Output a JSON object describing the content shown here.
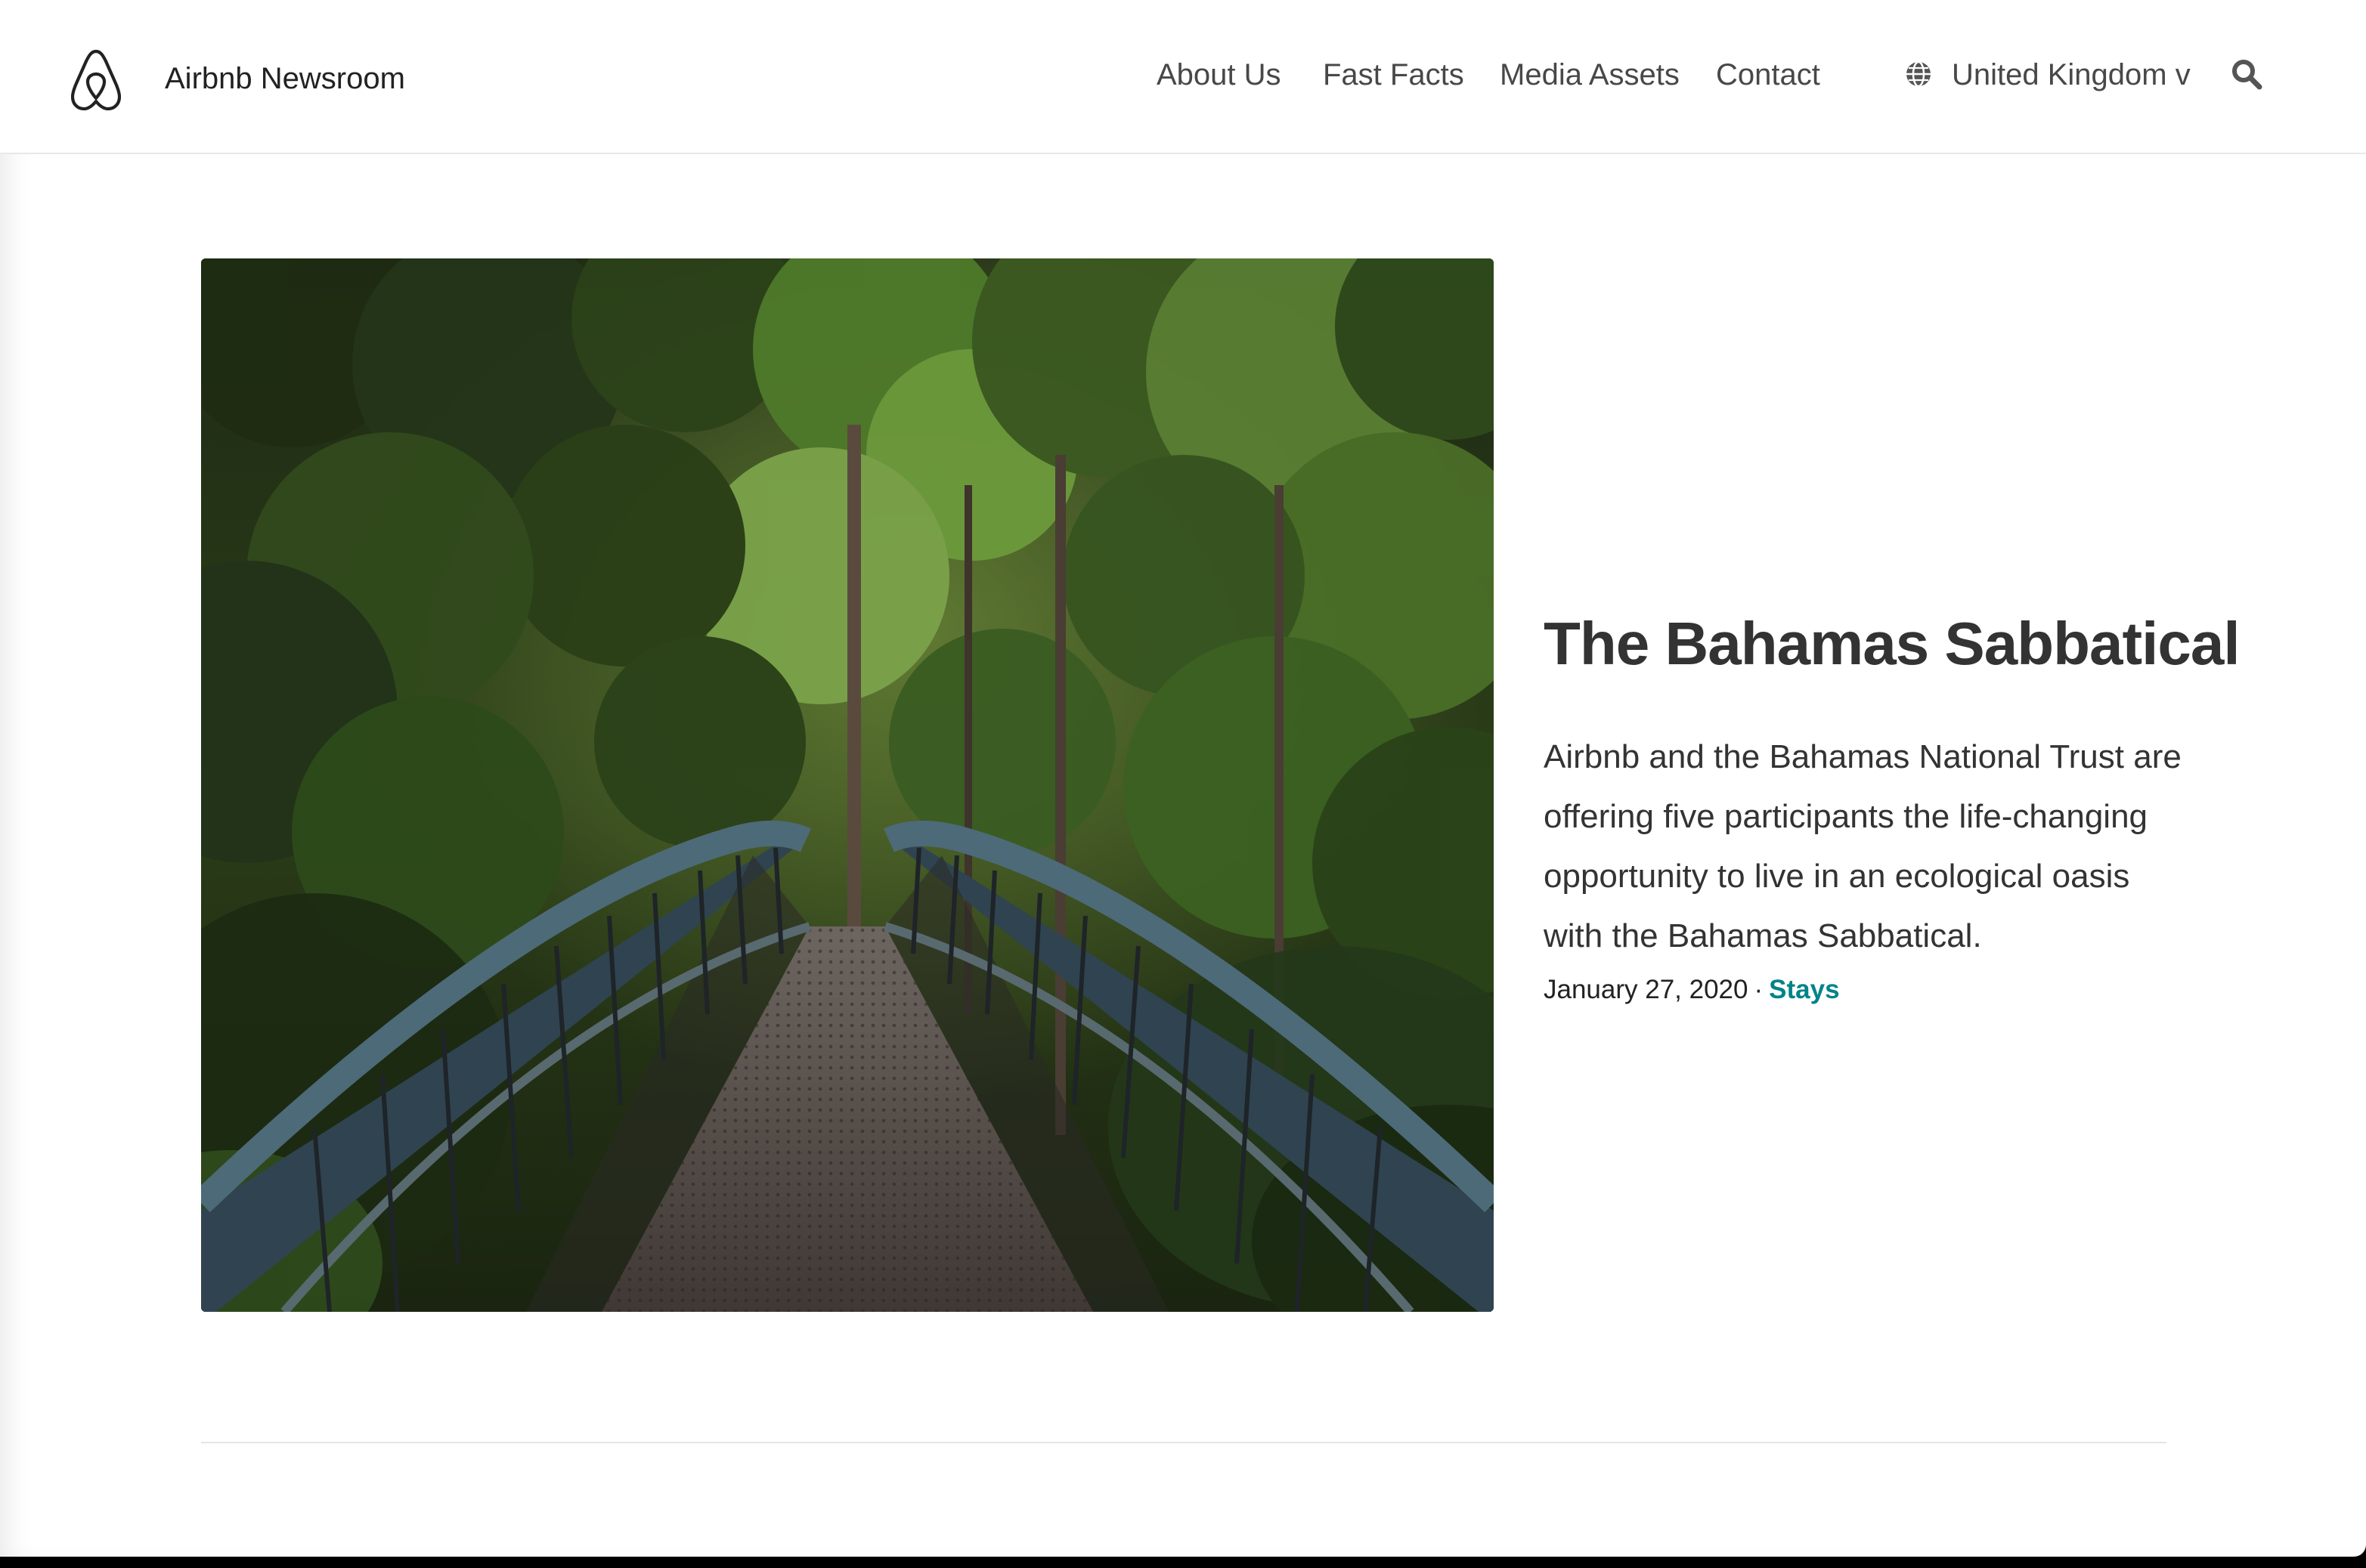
{
  "header": {
    "brand_name": "Airbnb Newsroom",
    "logo_icon": "airbnb-belo-icon",
    "nav": [
      {
        "label": "About Us"
      },
      {
        "label": "Fast Facts"
      },
      {
        "label": "Media Assets"
      },
      {
        "label": "Contact"
      }
    ],
    "region": {
      "icon": "globe-icon",
      "label": "United Kingdom v"
    },
    "search_icon": "search-icon"
  },
  "featured_article": {
    "image_description_icon": "hero-photo",
    "title": "The Bahamas Sabbatical",
    "summary": "Airbnb and the Bahamas National Trust are offering five participants the life-changing opportunity to live in an ecological oasis with the Bahamas Sabbatical.",
    "date": "January 27, 2020",
    "separator": "·",
    "category": "Stays"
  },
  "colors": {
    "accent": "#008489",
    "text": "#333333",
    "nav_text": "#484848",
    "divider": "#e5e5e5"
  }
}
